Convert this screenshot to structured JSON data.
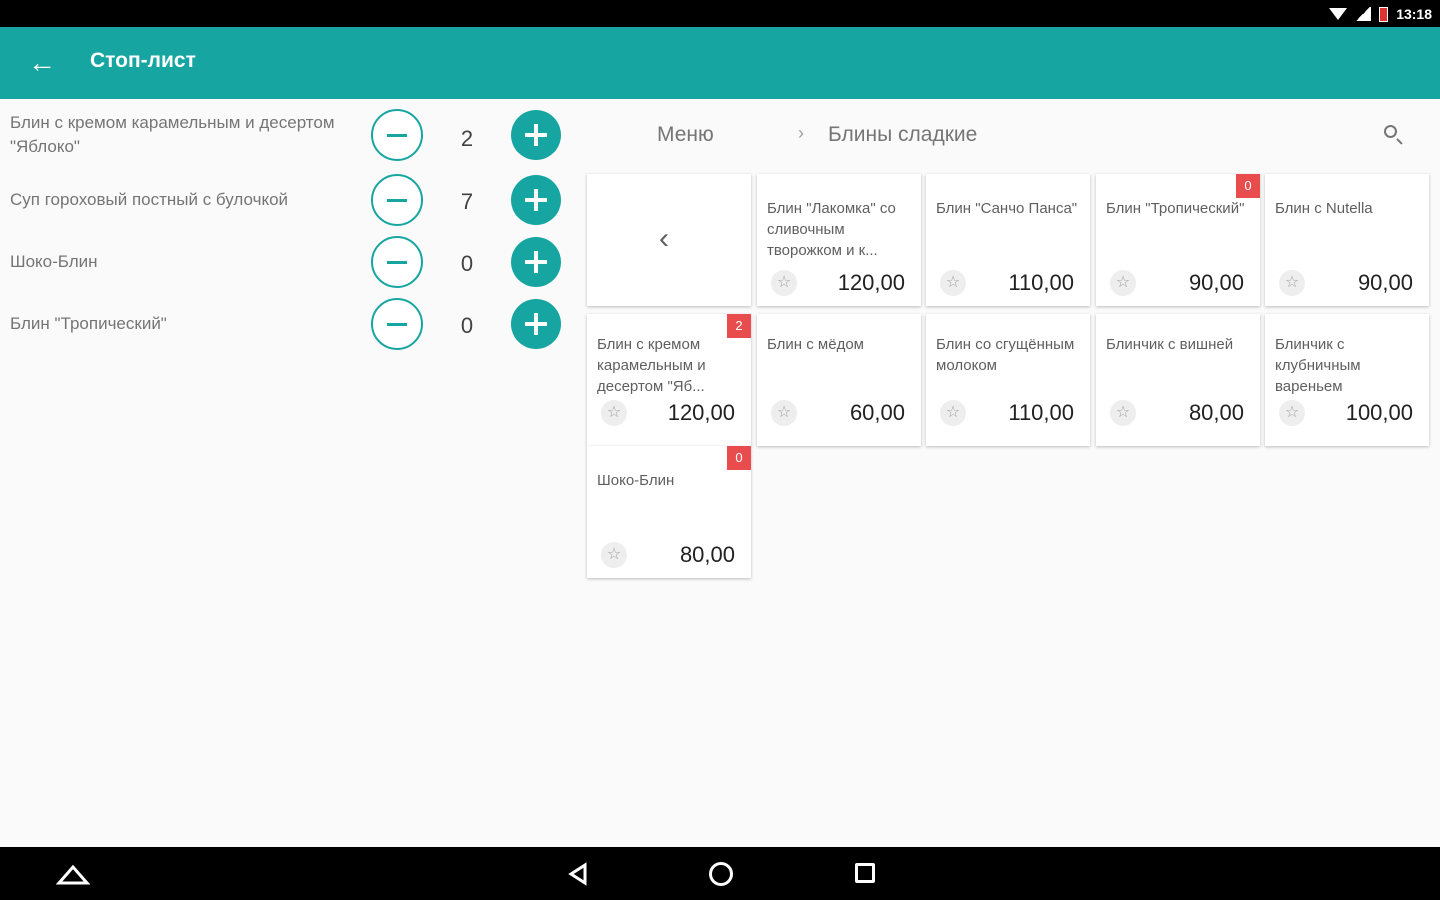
{
  "status_bar": {
    "time": "13:18",
    "wifi_icon": "wifi-icon",
    "signal_icon": "signal-icon",
    "battery_icon": "battery-icon"
  },
  "app_bar": {
    "back_icon": "arrow-back-icon",
    "title": "Стоп-лист",
    "color": "#17a5a1"
  },
  "stop_list": [
    {
      "name": "Блин с кремом карамельным и десертом \"Яблоко\"",
      "quantity": "2"
    },
    {
      "name": "Суп гороховый постный с булочкой",
      "quantity": "7"
    },
    {
      "name": "Шоко-Блин",
      "quantity": "0"
    },
    {
      "name": "Блин \"Тропический\"",
      "quantity": "0"
    }
  ],
  "breadcrumbs": {
    "root": "Меню",
    "separator": "›",
    "current": "Блины сладкие",
    "search_icon": "search-icon"
  },
  "menu_back_icon": "chevron-left-icon",
  "menu_items": [
    {
      "name": "Блин \"Лакомка\" со сливочным творожком и к...",
      "price": "120,00",
      "badge": ""
    },
    {
      "name": "Блин \"Санчо Панса\"",
      "price": "110,00",
      "badge": ""
    },
    {
      "name": "Блин \"Тропический\"",
      "price": "90,00",
      "badge": "0"
    },
    {
      "name": "Блин с Nutella",
      "price": "90,00",
      "badge": ""
    },
    {
      "name": "Блин с кремом карамельным и десертом \"Яб...",
      "price": "120,00",
      "badge": "2"
    },
    {
      "name": "Блин с мёдом",
      "price": "60,00",
      "badge": ""
    },
    {
      "name": "Блин со сгущённым молоком",
      "price": "110,00",
      "badge": ""
    },
    {
      "name": "Блинчик с вишней",
      "price": "80,00",
      "badge": ""
    },
    {
      "name": "Блинчик с клубничным вареньем",
      "price": "100,00",
      "badge": ""
    },
    {
      "name": "Шоко-Блин",
      "price": "80,00",
      "badge": "0"
    }
  ],
  "nav_bar": {
    "home_up_icon": "home-up-icon",
    "back_icon": "nav-back-icon",
    "home_icon": "nav-home-icon",
    "recents_icon": "nav-recents-icon"
  }
}
